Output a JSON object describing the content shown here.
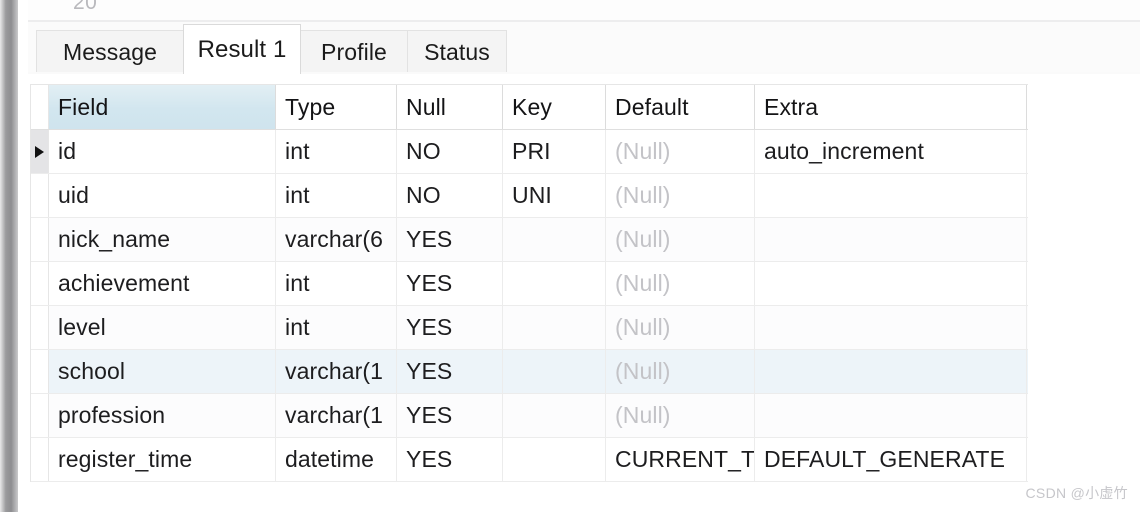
{
  "window": {
    "top_fragment": "20"
  },
  "tabs": [
    {
      "label": "Message",
      "active": false
    },
    {
      "label": "Result 1",
      "active": true
    },
    {
      "label": "Profile",
      "active": false
    },
    {
      "label": "Status",
      "active": false
    }
  ],
  "grid": {
    "columns": [
      "Field",
      "Type",
      "Null",
      "Key",
      "Default",
      "Extra"
    ],
    "sorted_column": "Field",
    "current_row_index": 0,
    "highlighted_row_index": 5,
    "null_token": "(Null)",
    "rows": [
      {
        "Field": "id",
        "Type": "int",
        "Null": "NO",
        "Key": "PRI",
        "Default": "(Null)",
        "Extra": "auto_increment"
      },
      {
        "Field": "uid",
        "Type": "int",
        "Null": "NO",
        "Key": "UNI",
        "Default": "(Null)",
        "Extra": ""
      },
      {
        "Field": "nick_name",
        "Type": "varchar(6",
        "Null": "YES",
        "Key": "",
        "Default": "(Null)",
        "Extra": ""
      },
      {
        "Field": "achievement",
        "Type": "int",
        "Null": "YES",
        "Key": "",
        "Default": "(Null)",
        "Extra": ""
      },
      {
        "Field": "level",
        "Type": "int",
        "Null": "YES",
        "Key": "",
        "Default": "(Null)",
        "Extra": ""
      },
      {
        "Field": "school",
        "Type": "varchar(1",
        "Null": "YES",
        "Key": "",
        "Default": "(Null)",
        "Extra": ""
      },
      {
        "Field": "profession",
        "Type": "varchar(1",
        "Null": "YES",
        "Key": "",
        "Default": "(Null)",
        "Extra": ""
      },
      {
        "Field": "register_time",
        "Type": "datetime",
        "Null": "YES",
        "Key": "",
        "Default": "CURRENT_T",
        "Extra": "DEFAULT_GENERATE"
      }
    ]
  },
  "watermark": "CSDN @小虚竹",
  "colors": {
    "sorted_header": "#d2e6ef",
    "row_highlight": "#edf4f9",
    "null_text": "#c3c3c7",
    "text": "#1d1d1f"
  }
}
